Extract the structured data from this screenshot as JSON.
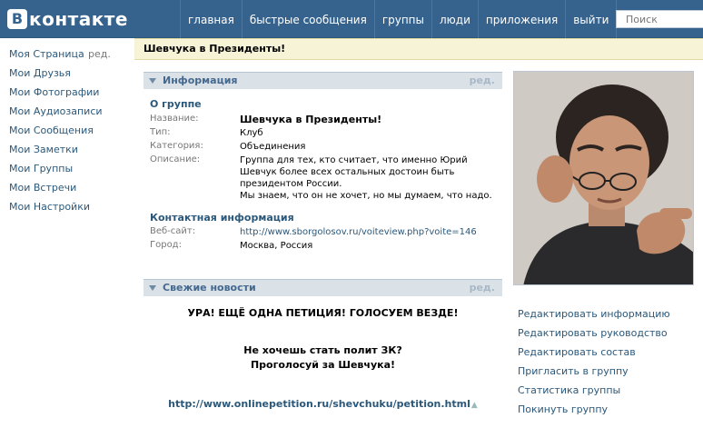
{
  "header": {
    "logo_letter": "В",
    "logo_text": "контакте",
    "nav": [
      "главная",
      "быстрые сообщения",
      "группы",
      "люди",
      "приложения",
      "выйти"
    ],
    "search_placeholder": "Поиск"
  },
  "sidebar": {
    "items": [
      {
        "label": "Моя Страница",
        "edit": "ред."
      },
      {
        "label": "Мои Друзья"
      },
      {
        "label": "Мои Фотографии"
      },
      {
        "label": "Мои Аудиозаписи"
      },
      {
        "label": "Мои Сообщения"
      },
      {
        "label": "Мои Заметки"
      },
      {
        "label": "Мои Группы"
      },
      {
        "label": "Мои Встречи"
      },
      {
        "label": "Мои Настройки"
      }
    ]
  },
  "page_title": "Шевчука в Президенты!",
  "info": {
    "header": "Информация",
    "edit": "ред.",
    "about_title": "О группе",
    "rows": [
      {
        "label": "Название:",
        "value": "Шевчука в Президенты!"
      },
      {
        "label": "Тип:",
        "value": "Клуб"
      },
      {
        "label": "Категория:",
        "value": "Объединения"
      },
      {
        "label": "Описание:",
        "value": "Группа для тех, кто считает, что именно Юрий Шевчук более всех остальных достоин быть президентом России."
      }
    ],
    "description_extra": "Мы знаем, что он не хочет, но мы думаем, что надо.",
    "contact_title": "Контактная информация",
    "contact_rows": [
      {
        "label": "Веб-сайт:",
        "value": "http://www.sborgolosov.ru/voiteview.php?voite=146"
      },
      {
        "label": "Город:",
        "value": "Москва, Россия"
      }
    ]
  },
  "news": {
    "header": "Свежие новости",
    "edit": "ред.",
    "line1": "УРА! ЕЩЁ ОДНА ПЕТИЦИЯ! ГОЛОСУЕМ ВЕЗДЕ!",
    "line2": "Не хочешь стать полит ЗК?",
    "line3": "Проголосуй за Шевчука!",
    "link": "http://www.onlinepetition.ru/shevchuku/petition.html"
  },
  "actions": [
    "Редактировать информацию",
    "Редактировать руководство",
    "Редактировать состав",
    "Пригласить в группу",
    "Статистика группы",
    "Покинуть группу"
  ],
  "colors": {
    "header": "#36638e",
    "link": "#2b587a",
    "section_header": "#dae2e8",
    "title_bar": "#f7f3d7"
  }
}
